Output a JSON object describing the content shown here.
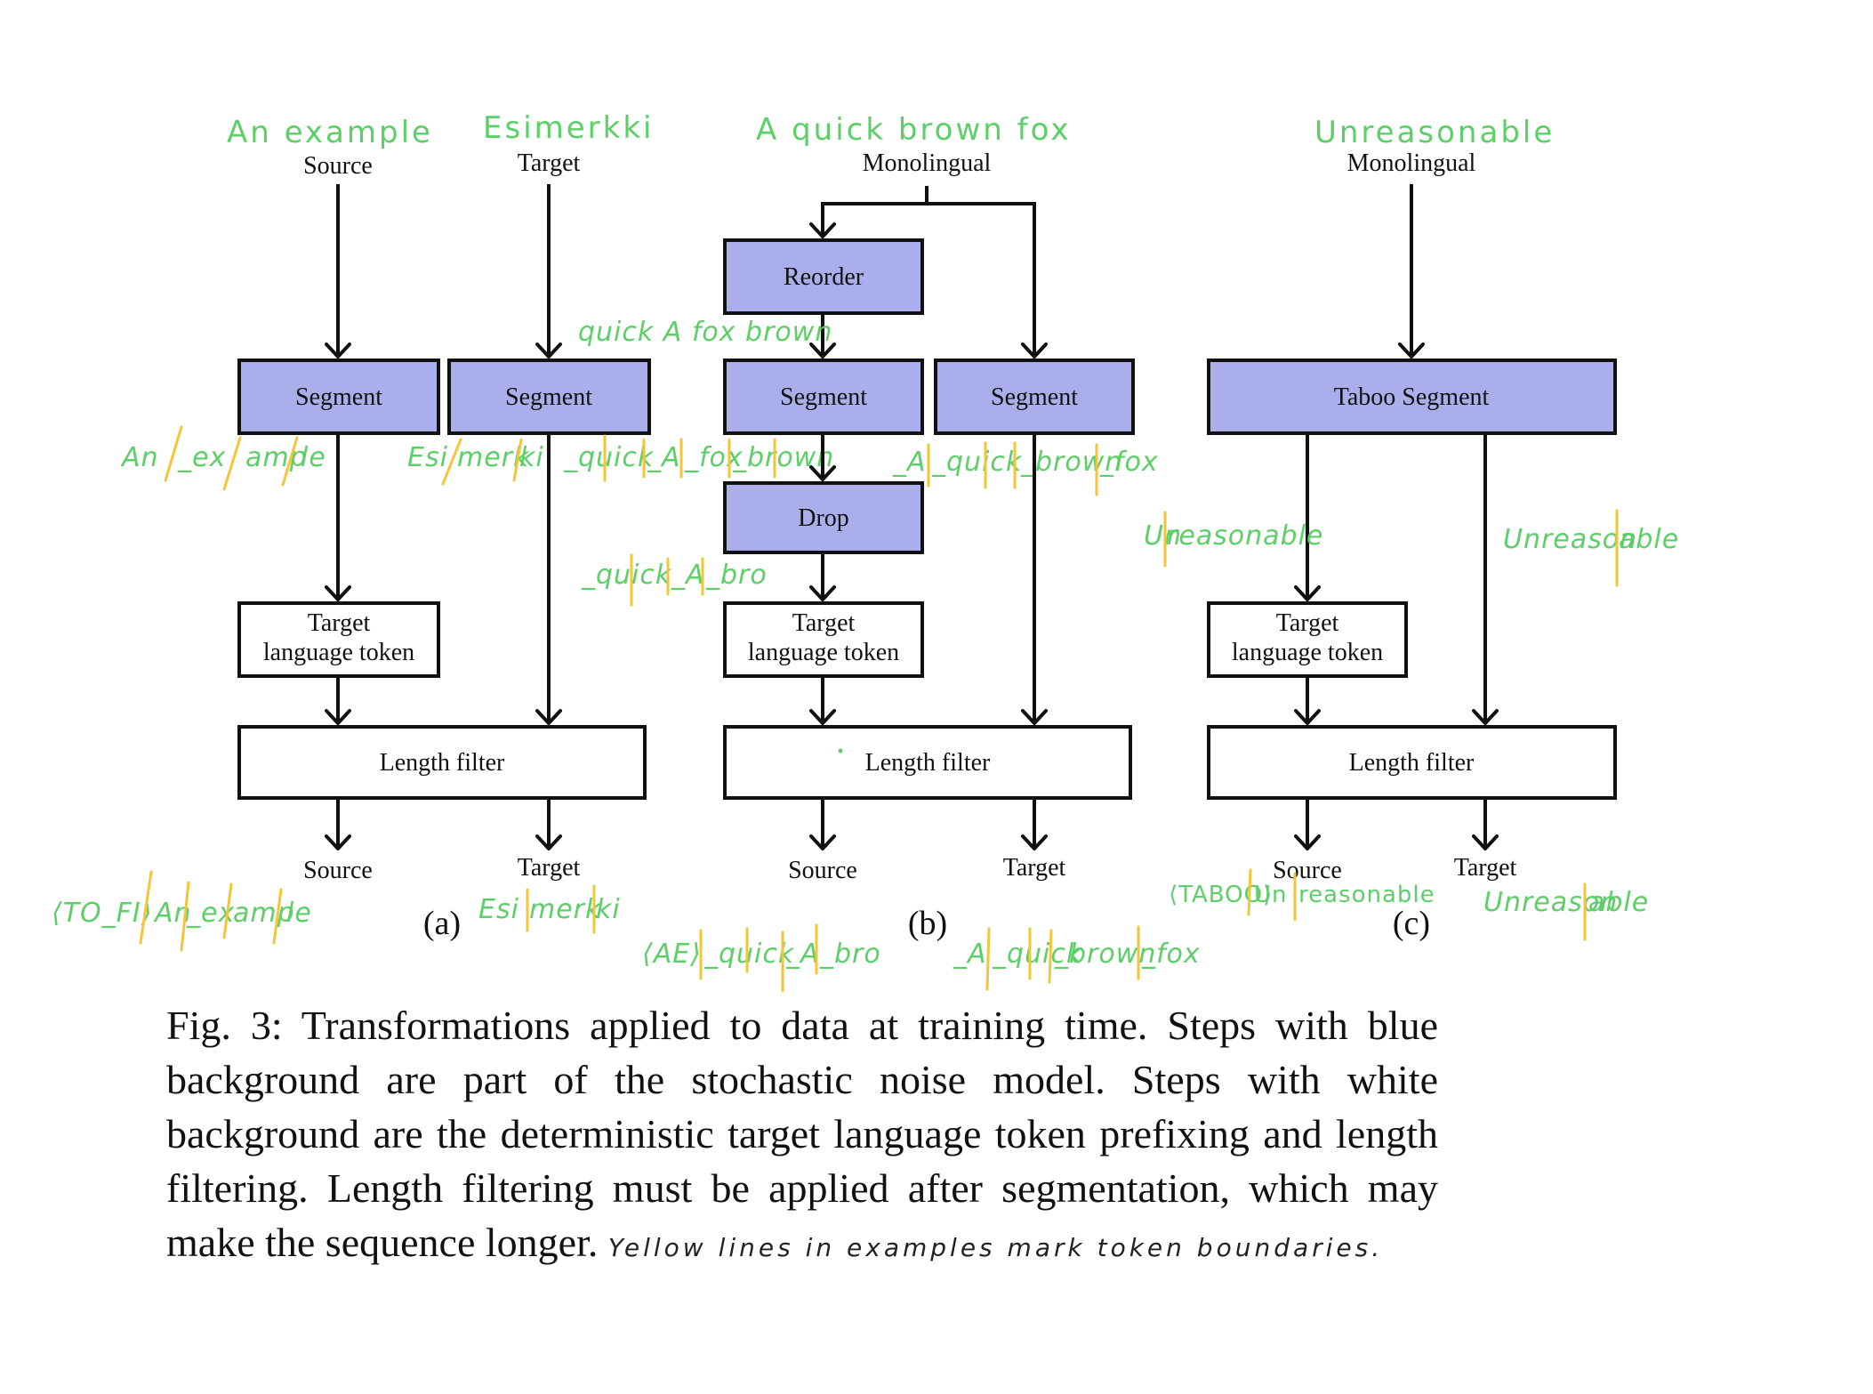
{
  "colors": {
    "stochastic_fill": "#aaaeea",
    "deterministic_fill": "#ffffff",
    "annotation_green": "#5dcf68",
    "token_boundary_yellow": "#f6c437"
  },
  "panels": {
    "a": {
      "sublabel": "(a)",
      "inputs": {
        "source": "Source",
        "target": "Target"
      },
      "input_examples": {
        "source": "An example",
        "target": "Esimerkki"
      },
      "boxes": {
        "segment_source": "Segment",
        "segment_target": "Segment",
        "target_language_token_line1": "Target",
        "target_language_token_line2": "language token",
        "length_filter": "Length filter"
      },
      "segmented_examples": {
        "source_tokens": [
          "An",
          "_ex",
          "amp",
          "le"
        ],
        "target_tokens": [
          "Esi",
          "merk",
          "ki"
        ]
      },
      "outputs": {
        "source": "Source",
        "target": "Target"
      },
      "output_examples": {
        "source_tokens": [
          "<TO_FI>",
          "An",
          "_ex",
          "amp",
          "le"
        ],
        "target_tokens": [
          "Esi",
          "merk",
          "ki"
        ]
      }
    },
    "b": {
      "sublabel": "(b)",
      "input": "Monolingual",
      "input_example": "A quick brown fox",
      "boxes": {
        "reorder": "Reorder",
        "segment_left": "Segment",
        "segment_right": "Segment",
        "drop": "Drop",
        "target_language_token_line1": "Target",
        "target_language_token_line2": "language token",
        "length_filter": "Length filter"
      },
      "reordered_example": "quick A fox brown",
      "segmented_left_tokens": [
        "_quick",
        "_A",
        "_fox",
        "_brown"
      ],
      "segmented_right_tokens": [
        "_A",
        "_quick",
        "_brown",
        "_fox"
      ],
      "dropped_tokens": [
        "_quick",
        "_A",
        "_bro"
      ],
      "outputs": {
        "source": "Source",
        "target": "Target"
      },
      "output_examples": {
        "source_tokens": [
          "<AE>",
          "_quick",
          "_A",
          "_bro"
        ],
        "target_tokens": [
          "_A",
          "_quick",
          "_brown",
          "_fox"
        ]
      }
    },
    "c": {
      "sublabel": "(c)",
      "input": "Monolingual",
      "input_example": "Unreasonable",
      "boxes": {
        "taboo_segment": "Taboo Segment",
        "target_language_token_line1": "Target",
        "target_language_token_line2": "language token",
        "length_filter": "Length filter"
      },
      "segmented_source_tokens": [
        "Un",
        "reasonable"
      ],
      "segmented_target_tokens": [
        "Unreason",
        "able"
      ],
      "outputs": {
        "source": "Source",
        "target": "Target"
      },
      "output_examples": {
        "source_tokens": [
          "<TABOO>",
          "Un",
          "reasonable"
        ],
        "target_tokens": [
          "Unreason",
          "able"
        ]
      }
    }
  },
  "caption": {
    "text": "Fig. 3: Transformations applied to data at training time. Steps with blue background are part of the stochastic noise model. Steps with white background are the deterministic target language token prefixing and length filtering. Length filtering must be applied after segmentation, which may make the sequence longer.",
    "handwritten_note": "Yellow lines in examples mark token boundaries."
  }
}
